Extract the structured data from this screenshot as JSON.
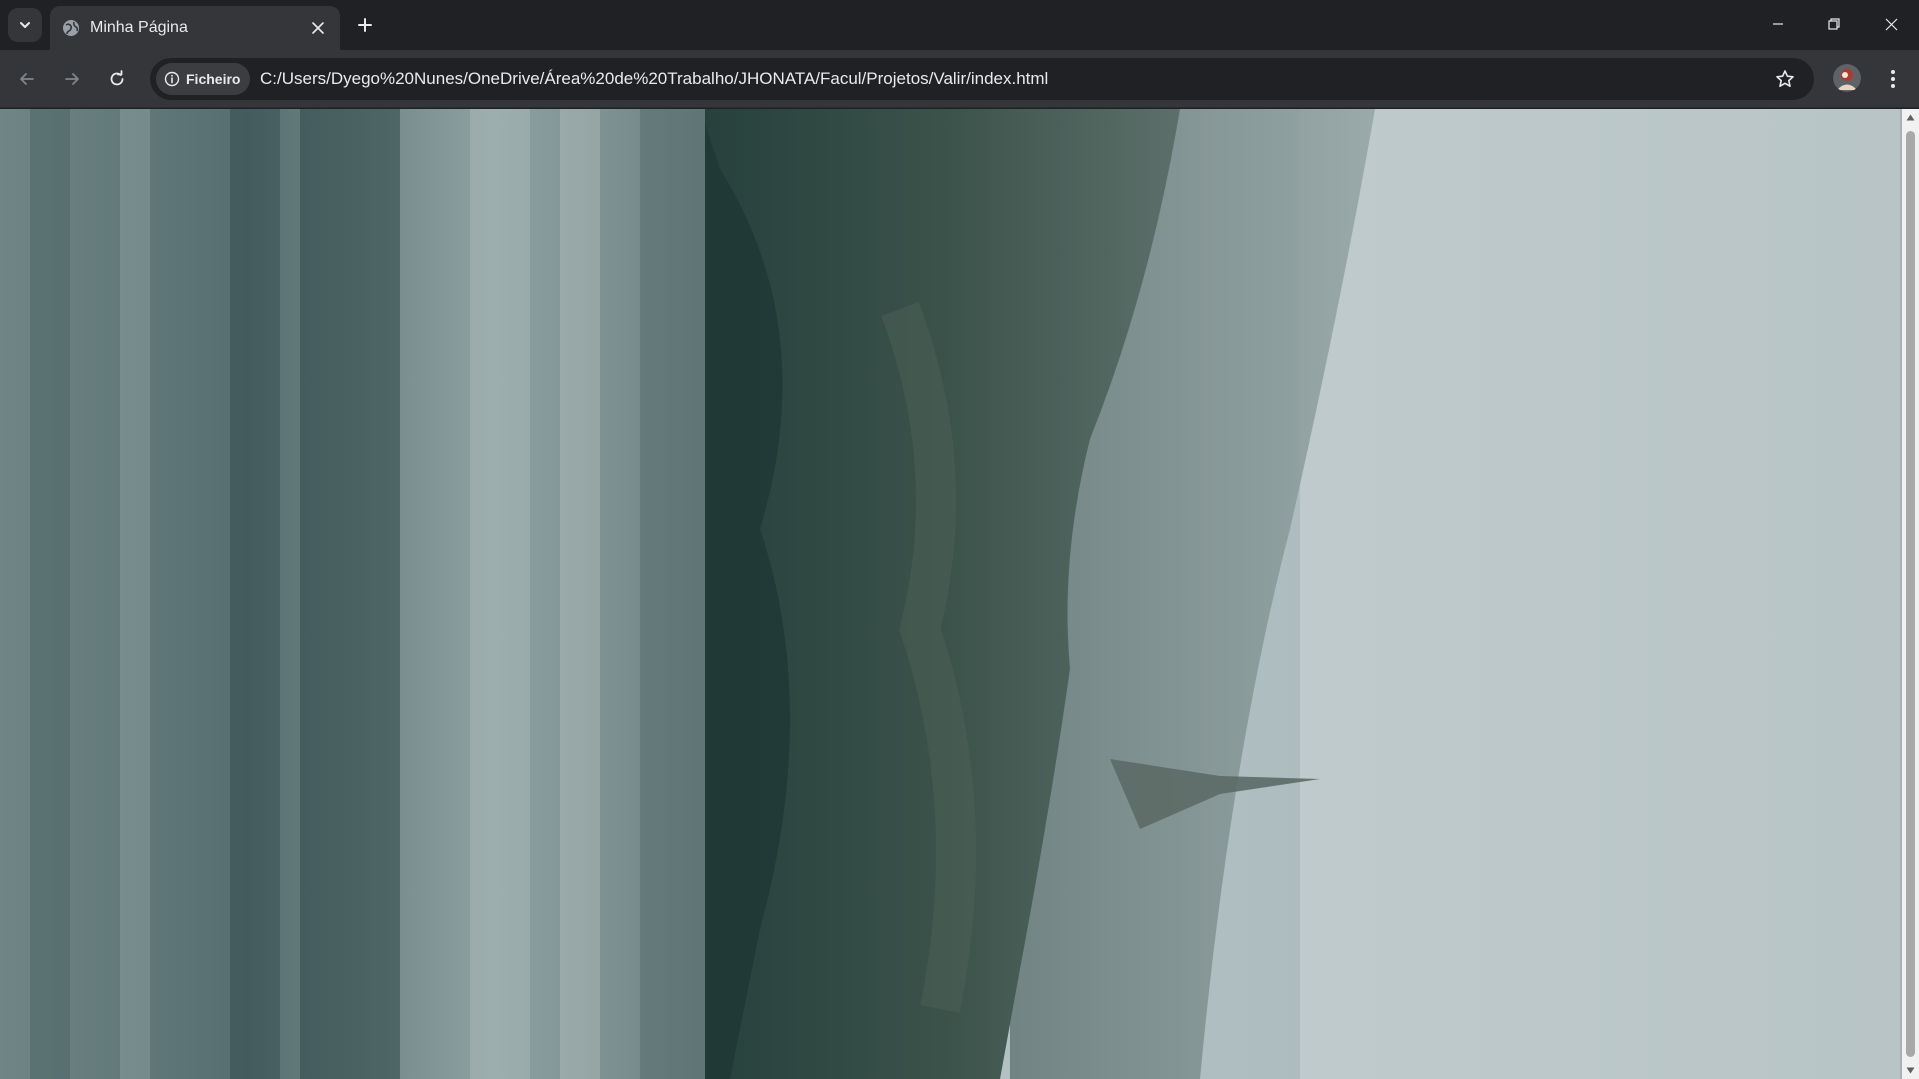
{
  "tab": {
    "title": "Minha Página",
    "favicon": "globe-icon"
  },
  "toolbar": {
    "site_chip_label": "Ficheiro",
    "url": "C:/Users/Dyego%20Nunes/OneDrive/Área%20de%20Trabalho/JHONATA/Facul/Projetos/Valir/index.html"
  },
  "icons": {
    "tab_search": "chevron-down-icon",
    "tab_close": "close-icon",
    "new_tab": "plus-icon",
    "minimize": "minimize-icon",
    "restore": "restore-icon",
    "window_close": "close-icon",
    "back": "arrow-left-icon",
    "forward": "arrow-right-icon",
    "reload": "reload-icon",
    "site_info": "info-icon",
    "bookmark": "star-icon",
    "profile": "avatar",
    "menu": "kebab-icon"
  },
  "colors": {
    "frame": "#202124",
    "toolbar": "#35363a",
    "text": "#e8eaed"
  },
  "content": {
    "image_subject": "foggy coastal landscape rotated sideways"
  }
}
